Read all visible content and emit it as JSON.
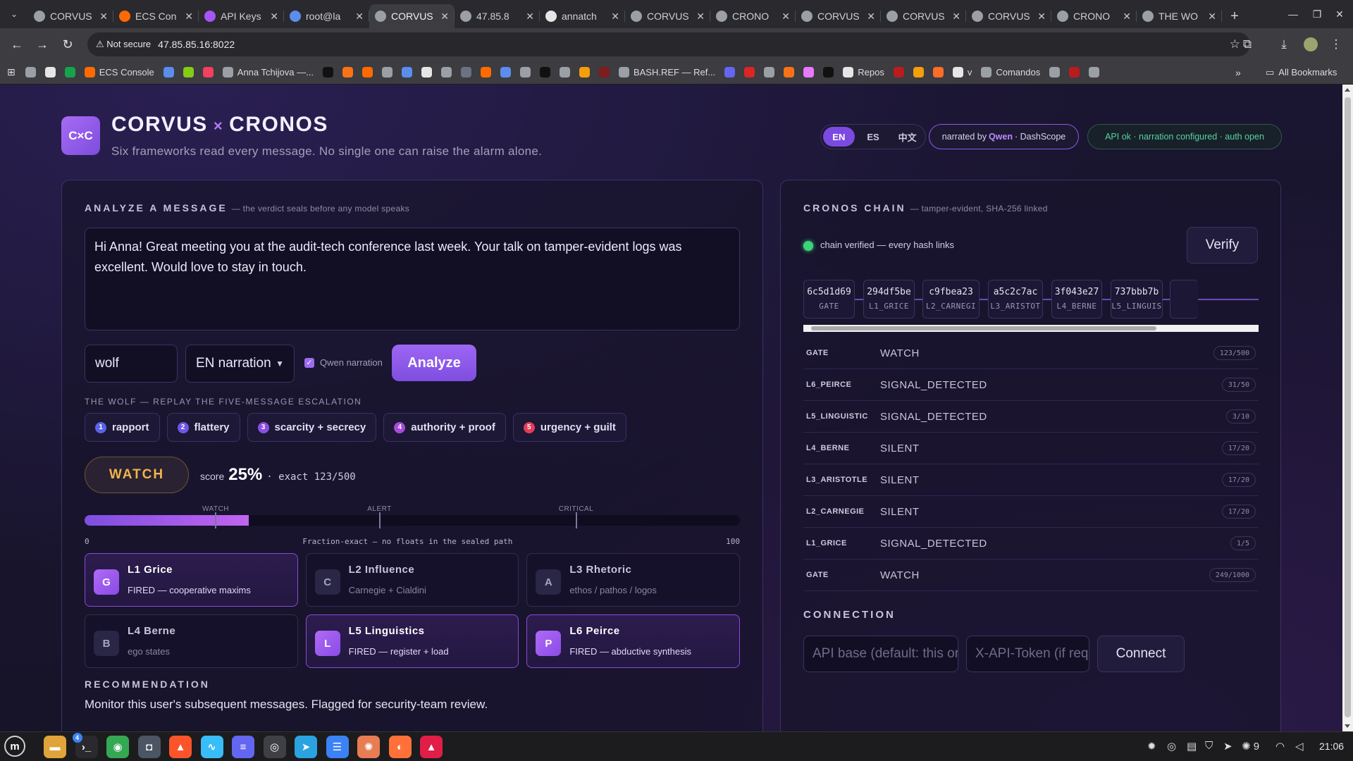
{
  "browser": {
    "tabs": [
      {
        "title": "CORVUS",
        "fav": "#9aa0a6",
        "active": false
      },
      {
        "title": "ECS Con",
        "fav": "#ff6a00",
        "active": false
      },
      {
        "title": "API Keys",
        "fav": "#a855f7",
        "active": false
      },
      {
        "title": "root@la",
        "fav": "#5b8def",
        "active": false
      },
      {
        "title": "CORVUS",
        "fav": "#9aa0a6",
        "active": true
      },
      {
        "title": "47.85.8",
        "fav": "#9aa0a6",
        "active": false
      },
      {
        "title": "annatch",
        "fav": "#e6e6e6",
        "active": false
      },
      {
        "title": "CORVUS",
        "fav": "#9aa0a6",
        "active": false
      },
      {
        "title": "CRONO",
        "fav": "#9aa0a6",
        "active": false
      },
      {
        "title": "CORVUS",
        "fav": "#9aa0a6",
        "active": false
      },
      {
        "title": "CORVUS",
        "fav": "#9aa0a6",
        "active": false
      },
      {
        "title": "CORVUS",
        "fav": "#9aa0a6",
        "active": false
      },
      {
        "title": "CRONO",
        "fav": "#9aa0a6",
        "active": false
      },
      {
        "title": "THE WO",
        "fav": "#9aa0a6",
        "active": false
      }
    ],
    "address": {
      "security": "Not secure",
      "url": "47.85.85.16:8022"
    },
    "bookmarks": [
      {
        "label": "",
        "color": "#9aa0a6"
      },
      {
        "label": "",
        "color": "#e6e6e6"
      },
      {
        "label": "",
        "color": "#16a34a"
      },
      {
        "label": "ECS Console",
        "color": "#ff6a00"
      },
      {
        "label": "",
        "color": "#5b8def"
      },
      {
        "label": "",
        "color": "#84cc16"
      },
      {
        "label": "",
        "color": "#f43f5e"
      },
      {
        "label": "Anna Tchijova —...",
        "color": "#9aa0a6"
      },
      {
        "label": "",
        "color": "#111111"
      },
      {
        "label": "",
        "color": "#f97316"
      },
      {
        "label": "",
        "color": "#ff6a00"
      },
      {
        "label": "",
        "color": "#9aa0a6"
      },
      {
        "label": "",
        "color": "#5b8def"
      },
      {
        "label": "",
        "color": "#e6e6e6"
      },
      {
        "label": "",
        "color": "#9aa0a6"
      },
      {
        "label": "",
        "color": "#6b7280"
      },
      {
        "label": "",
        "color": "#ff6a00"
      },
      {
        "label": "",
        "color": "#5b8def"
      },
      {
        "label": "",
        "color": "#9aa0a6"
      },
      {
        "label": "",
        "color": "#111111"
      },
      {
        "label": "",
        "color": "#9aa0a6"
      },
      {
        "label": "",
        "color": "#f59e0b"
      },
      {
        "label": "",
        "color": "#7f1d1d"
      },
      {
        "label": "BASH.REF — Ref...",
        "color": "#9aa0a6"
      },
      {
        "label": "",
        "color": "#6366f1"
      },
      {
        "label": "",
        "color": "#dc2626"
      },
      {
        "label": "",
        "color": "#9aa0a6"
      },
      {
        "label": "",
        "color": "#f97316"
      },
      {
        "label": "",
        "color": "#e879f9"
      },
      {
        "label": "",
        "color": "#111111"
      },
      {
        "label": "Repos",
        "color": "#e6e6e6"
      },
      {
        "label": "",
        "color": "#b91c1c"
      },
      {
        "label": "",
        "color": "#f59e0b"
      },
      {
        "label": "",
        "color": "#fc6d26"
      },
      {
        "label": "v",
        "color": "#e6e6e6"
      },
      {
        "label": "Comandos",
        "color": "#9aa0a6"
      },
      {
        "label": "",
        "color": "#9aa0a6"
      },
      {
        "label": "",
        "color": "#b91c1c"
      },
      {
        "label": "",
        "color": "#9aa0a6"
      }
    ],
    "all_bookmarks": "All Bookmarks"
  },
  "header": {
    "logo": "C×C",
    "title_a": "CORVUS",
    "title_x": "×",
    "title_b": "CRONOS",
    "subtitle": "Six frameworks read every message. No single one can raise the alarm alone.",
    "langs": [
      "EN",
      "ES",
      "中文"
    ],
    "active_lang": "EN",
    "narration_pre": "narrated by",
    "narration_brand": "Qwen",
    "narration_post": "· DashScope",
    "api_status": "API ok · narration configured · auth open"
  },
  "analyze": {
    "title": "ANALYZE A MESSAGE",
    "note": "— the verdict seals before any model speaks",
    "message": "Hi Anna! Great meeting you at the audit-tech conference last week. Your talk on tamper-evident logs was excellent. Would love to stay in touch.",
    "persona": "wolf",
    "narration_option": "EN narration",
    "qwen_label": "Qwen narration",
    "analyze_label": "Analyze",
    "wolf_label": "THE WOLF — REPLAY THE FIVE-MESSAGE ESCALATION",
    "chips": [
      {
        "num": "1",
        "label": "rapport",
        "color": "#5b63e8"
      },
      {
        "num": "2",
        "label": "flattery",
        "color": "#6d57e6"
      },
      {
        "num": "3",
        "label": "scarcity + secrecy",
        "color": "#8a4fe0"
      },
      {
        "num": "4",
        "label": "authority + proof",
        "color": "#a54cd8"
      },
      {
        "num": "5",
        "label": "urgency + guilt",
        "color": "#e23d5a"
      }
    ],
    "verdict": "WATCH",
    "score_prefix": "score",
    "score_value": "25%",
    "score_exact": "· exact 123/500",
    "meter": {
      "value": 25,
      "max": 100,
      "min_label": "0",
      "max_label": "100",
      "note": "Fraction-exact — no floats in the sealed path",
      "marks": [
        {
          "label": "WATCH",
          "at": 20
        },
        {
          "label": "ALERT",
          "at": 45
        },
        {
          "label": "CRITICAL",
          "at": 75
        }
      ]
    },
    "frameworks": [
      {
        "badge": "G",
        "name": "L1 Grice",
        "sub": "FIRED — cooperative maxims",
        "fired": true
      },
      {
        "badge": "C",
        "name": "L2 Influence",
        "sub": "Carnegie + Cialdini",
        "fired": false
      },
      {
        "badge": "A",
        "name": "L3 Rhetoric",
        "sub": "ethos / pathos / logos",
        "fired": false
      },
      {
        "badge": "B",
        "name": "L4 Berne",
        "sub": "ego states",
        "fired": false
      },
      {
        "badge": "L",
        "name": "L5 Linguistics",
        "sub": "FIRED — register + load",
        "fired": true
      },
      {
        "badge": "P",
        "name": "L6 Peirce",
        "sub": "FIRED — abductive synthesis",
        "fired": true
      }
    ],
    "rec_title": "RECOMMENDATION",
    "rec_text": "Monitor this user's subsequent messages. Flagged for security-team review."
  },
  "chain": {
    "title": "CRONOS CHAIN",
    "note": "— tamper-evident, SHA-256 linked",
    "status": "chain verified — every hash links",
    "verify_label": "Verify",
    "blocks": [
      {
        "hash": "6c5d1d69",
        "label": "GATE"
      },
      {
        "hash": "294df5be",
        "label": "L1_GRICE"
      },
      {
        "hash": "c9fbea23",
        "label": "L2_CARNEGI"
      },
      {
        "hash": "a5c2c7ac",
        "label": "L3_ARISTOT"
      },
      {
        "hash": "3f043e27",
        "label": "L4_BERNE"
      },
      {
        "hash": "737bbb7b",
        "label": "L5_LINGUIS"
      }
    ],
    "rows": [
      {
        "layer": "GATE",
        "verdict": "WATCH",
        "count": "123/500"
      },
      {
        "layer": "L6_PEIRCE",
        "verdict": "SIGNAL_DETECTED",
        "count": "31/50"
      },
      {
        "layer": "L5_LINGUISTIC",
        "verdict": "SIGNAL_DETECTED",
        "count": "3/10"
      },
      {
        "layer": "L4_BERNE",
        "verdict": "SILENT",
        "count": "17/20"
      },
      {
        "layer": "L3_ARISTOTLE",
        "verdict": "SILENT",
        "count": "17/20"
      },
      {
        "layer": "L2_CARNEGIE",
        "verdict": "SILENT",
        "count": "17/20"
      },
      {
        "layer": "L1_GRICE",
        "verdict": "SIGNAL_DETECTED",
        "count": "1/5"
      },
      {
        "layer": "GATE",
        "verdict": "WATCH",
        "count": "249/1000"
      }
    ]
  },
  "connection": {
    "title": "CONNECTION",
    "api_base_placeholder": "API base (default: this origin)",
    "token_placeholder": "X-API-Token (if required)",
    "connect_label": "Connect"
  },
  "taskbar": {
    "apps": [
      {
        "name": "files",
        "color": "#e0a43a",
        "glyph": "▬"
      },
      {
        "name": "terminal",
        "color": "#2a2a2e",
        "glyph": "›_"
      },
      {
        "name": "chrome",
        "color": "#34a853",
        "glyph": "◉"
      },
      {
        "name": "camera",
        "color": "#4b5563",
        "glyph": "◘"
      },
      {
        "name": "brave",
        "color": "#fb542b",
        "glyph": "▲"
      },
      {
        "name": "monitor",
        "color": "#38bdf8",
        "glyph": "∿"
      },
      {
        "name": "text-editor",
        "color": "#6366f1",
        "glyph": "≡"
      },
      {
        "name": "obs",
        "color": "#3f3f46",
        "glyph": "◎"
      },
      {
        "name": "telegram",
        "color": "#2aa3e0",
        "glyph": "➤"
      },
      {
        "name": "notes",
        "color": "#3b82f6",
        "glyph": "☰"
      },
      {
        "name": "claude",
        "color": "#e87c52",
        "glyph": "✺"
      },
      {
        "name": "firefox",
        "color": "#ff7139",
        "glyph": "◐"
      },
      {
        "name": "photos",
        "color": "#e11d48",
        "glyph": "▲"
      }
    ],
    "badge_terminal": "4",
    "tray_count": "9",
    "clock": "21:06"
  }
}
